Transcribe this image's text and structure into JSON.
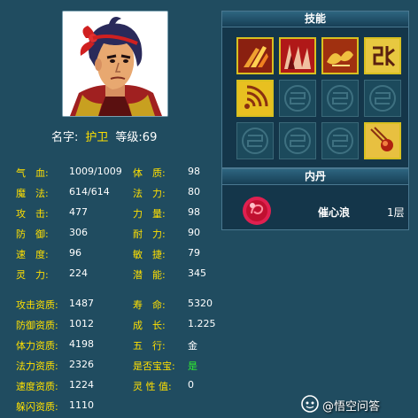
{
  "character": {
    "name_label": "名字:",
    "name": "护卫",
    "level_label": "等级:",
    "level": "69"
  },
  "stats": [
    {
      "label": "气　血:",
      "value": "1009/1009"
    },
    {
      "label": "魔　法:",
      "value": "614/614"
    },
    {
      "label": "攻　击:",
      "value": "477"
    },
    {
      "label": "防　御:",
      "value": "306"
    },
    {
      "label": "速　度:",
      "value": "96"
    },
    {
      "label": "灵　力:",
      "value": "224"
    }
  ],
  "attributes": [
    {
      "label": "体　质:",
      "value": "98"
    },
    {
      "label": "法　力:",
      "value": "80"
    },
    {
      "label": "力　量:",
      "value": "98"
    },
    {
      "label": "耐　力:",
      "value": "90"
    },
    {
      "label": "敏　捷:",
      "value": "79"
    },
    {
      "label": "潜　能:",
      "value": "345"
    }
  ],
  "aptitudes": [
    {
      "label": "攻击资质:",
      "value": "1487"
    },
    {
      "label": "防御资质:",
      "value": "1012"
    },
    {
      "label": "体力资质:",
      "value": "4198"
    },
    {
      "label": "法力资质:",
      "value": "2326"
    },
    {
      "label": "速度资质:",
      "value": "1224"
    },
    {
      "label": "躲闪资质:",
      "value": "1110"
    }
  ],
  "growth": [
    {
      "label": "寿　命:",
      "value": "5320"
    },
    {
      "label": "成　长:",
      "value": "1.225"
    },
    {
      "label": "五　行:",
      "value": "金"
    },
    {
      "label": "是否宝宝:",
      "value": "是"
    },
    {
      "label": "灵 性 值:",
      "value": "0"
    }
  ],
  "skills_panel": {
    "title": "技能",
    "slots": [
      {
        "icon": "claw-strike-skill-icon",
        "filled": true
      },
      {
        "icon": "blood-strike-skill-icon",
        "filled": true
      },
      {
        "icon": "flying-beast-skill-icon",
        "filled": true
      },
      {
        "icon": "rune-skill-icon",
        "filled": true
      },
      {
        "icon": "sound-wave-skill-icon",
        "filled": true
      },
      {
        "icon": "empty-slot-icon",
        "filled": false
      },
      {
        "icon": "empty-slot-icon",
        "filled": false
      },
      {
        "icon": "empty-slot-icon",
        "filled": false
      },
      {
        "icon": "empty-slot-icon",
        "filled": false
      },
      {
        "icon": "empty-slot-icon",
        "filled": false
      },
      {
        "icon": "empty-slot-icon",
        "filled": false
      },
      {
        "icon": "meteor-skill-icon",
        "filled": true
      }
    ]
  },
  "inner_dan": {
    "title": "内丹",
    "name": "催心浪",
    "level": "1层",
    "icon": "red-orb-icon"
  },
  "watermark": {
    "text": "@悟空问答",
    "icon": "wukong-logo-icon"
  },
  "colors": {
    "background": "#204c60",
    "label": "#ffe000",
    "value": "#ffffff",
    "highlight_value": "#30f030",
    "skill_border": "#d8c020"
  }
}
